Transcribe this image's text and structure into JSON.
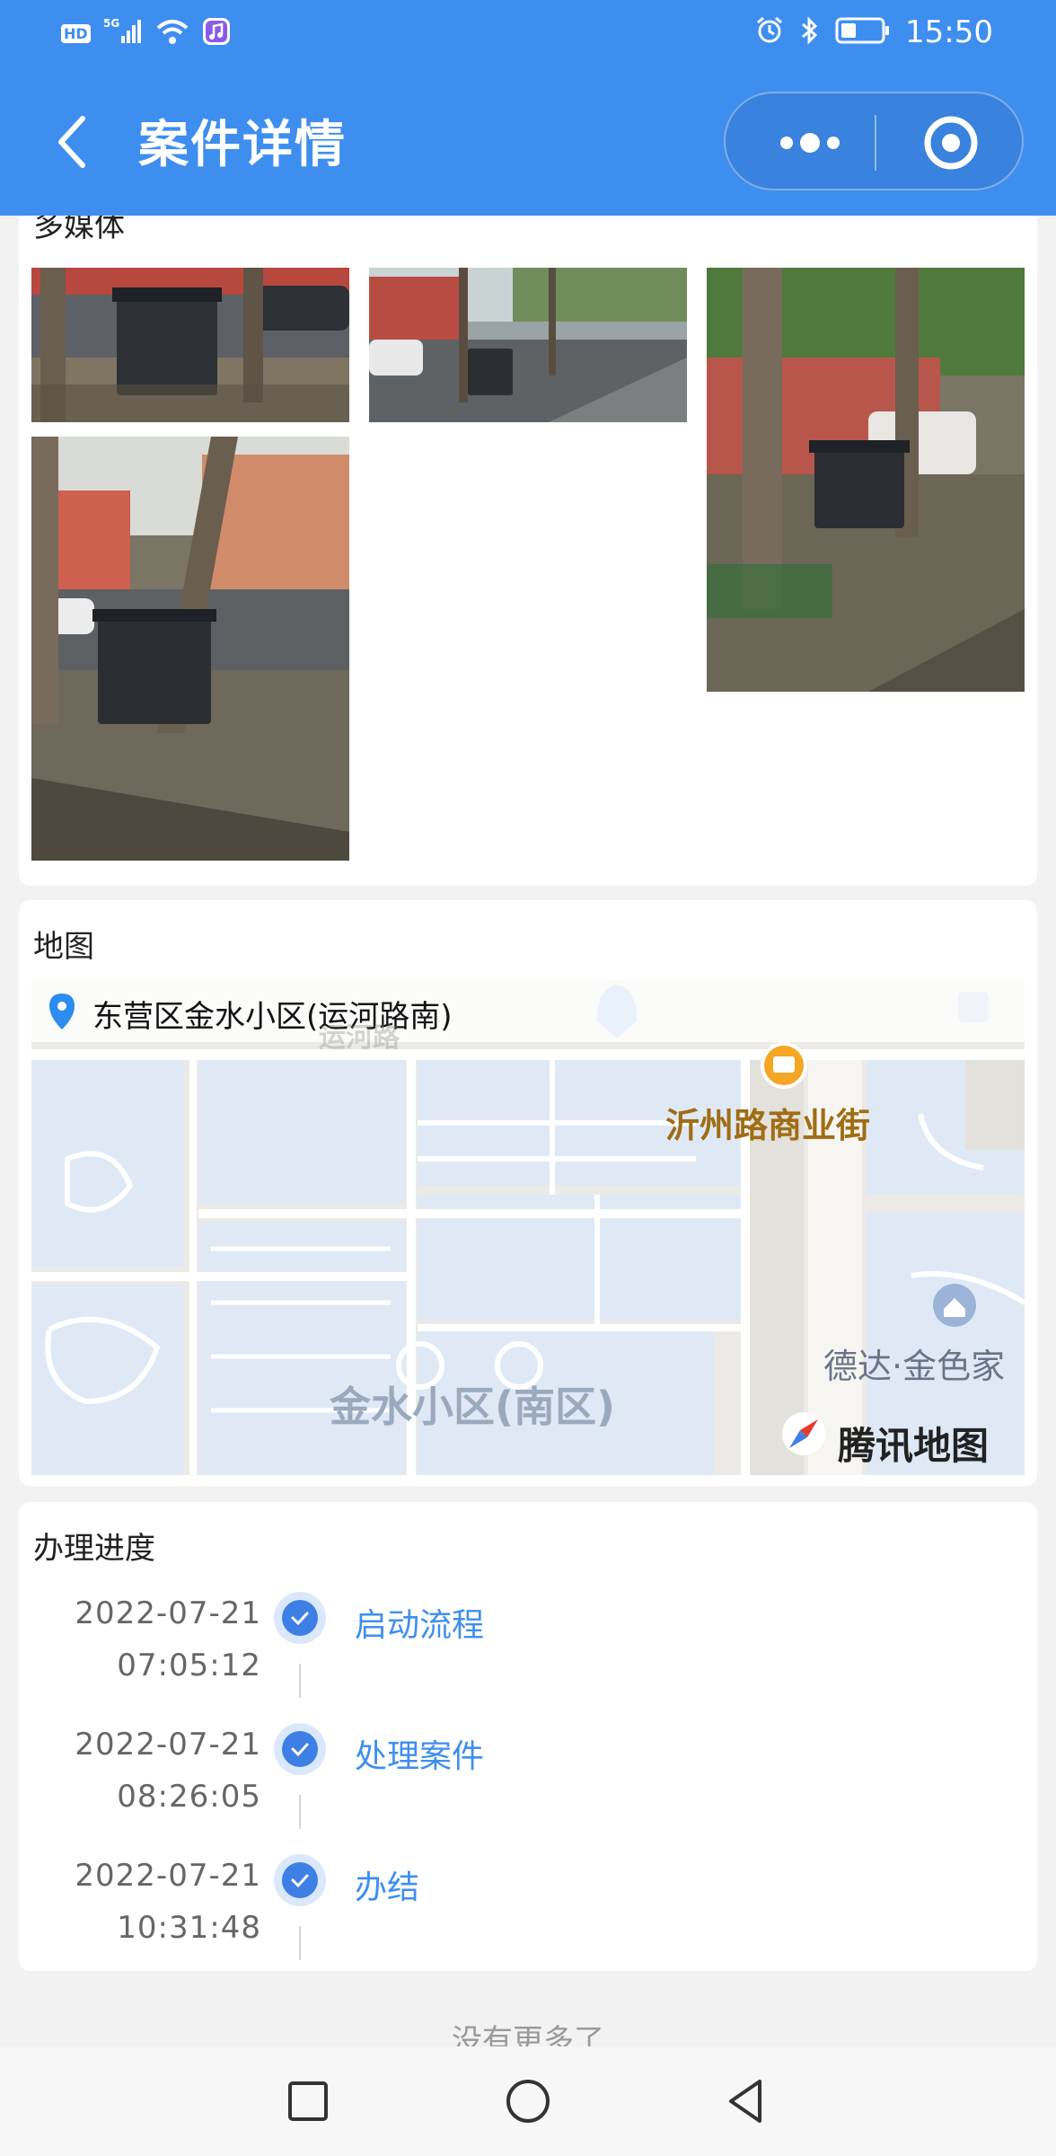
{
  "status_bar": {
    "network_badges": [
      "HD",
      "5G"
    ],
    "time": "15:50"
  },
  "nav": {
    "title": "案件详情",
    "back_icon": "chevron-left-icon",
    "more_icon": "more-dots-icon",
    "close_icon": "target-circle-icon"
  },
  "media": {
    "title": "多媒体",
    "photos": [
      {
        "name": "photo-1",
        "subject": "garbage-bin-street"
      },
      {
        "name": "photo-2",
        "subject": "garbage-bin-street"
      },
      {
        "name": "photo-3",
        "subject": "garbage-bin-street"
      },
      {
        "name": "photo-4",
        "subject": "garbage-bin-street"
      }
    ]
  },
  "map": {
    "title": "地图",
    "address": "东营区金水小区(运河路南)",
    "labels": {
      "road": "运河路",
      "poi_street": "沂州路商业街",
      "district": "金水小区(南区)",
      "poi_right": "德达·金色家",
      "brand": "腾讯地图"
    }
  },
  "progress": {
    "title": "办理进度",
    "steps": [
      {
        "date": "2022-07-21",
        "time": "07:05:12",
        "label": "启动流程"
      },
      {
        "date": "2022-07-21",
        "time": "08:26:05",
        "label": "处理案件"
      },
      {
        "date": "2022-07-21",
        "time": "10:31:48",
        "label": "办结"
      }
    ]
  },
  "footer": {
    "no_more": "没有更多了"
  },
  "colors": {
    "primary": "#3e8ef0",
    "link": "#3e8ef0",
    "check": "#3e7fe6"
  }
}
